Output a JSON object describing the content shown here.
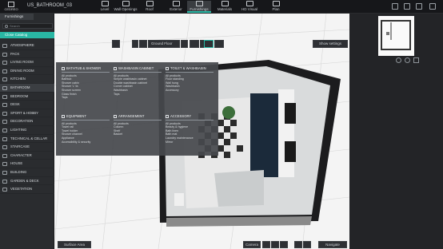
{
  "app": {
    "logo_text": "CEDREO",
    "project_title": "US_BATHROOM_03"
  },
  "toolbar": [
    {
      "label": "Level",
      "icon": "level-icon",
      "active": false
    },
    {
      "label": "Wall Openings",
      "icon": "door-icon",
      "active": false
    },
    {
      "label": "Roof",
      "icon": "roof-icon",
      "active": false
    },
    {
      "label": "Exterior",
      "icon": "house-icon",
      "active": false
    },
    {
      "label": "Furnishings",
      "icon": "sofa-icon",
      "active": true
    },
    {
      "label": "Materials",
      "icon": "paint-icon",
      "active": false
    },
    {
      "label": "HD Visual",
      "icon": "camera-icon",
      "active": false
    },
    {
      "label": "Plan",
      "icon": "plan-icon",
      "active": false
    }
  ],
  "sidebar": {
    "tab": "Furnishings",
    "search_placeholder": "Search",
    "close_catalog": "Close Catalog",
    "categories": [
      {
        "label": "ATMOSPHERE",
        "active": false
      },
      {
        "label": "PACK",
        "active": false
      },
      {
        "label": "LIVING ROOM",
        "active": false
      },
      {
        "label": "DINING ROOM",
        "active": false
      },
      {
        "label": "KITCHEN",
        "active": false
      },
      {
        "label": "BATHROOM",
        "active": true
      },
      {
        "label": "BEDROOM",
        "active": false
      },
      {
        "label": "DESK",
        "active": false
      },
      {
        "label": "SPORT & HOBBY",
        "active": false
      },
      {
        "label": "DECORATION",
        "active": false
      },
      {
        "label": "LIGHTING",
        "active": false
      },
      {
        "label": "TECHNICAL & CELLAR",
        "active": false
      },
      {
        "label": "STAIRCASE",
        "active": false
      },
      {
        "label": "CHARACTER",
        "active": false
      },
      {
        "label": "HOUSE",
        "active": false
      },
      {
        "label": "BUILDING",
        "active": false
      },
      {
        "label": "GARDEN & DECK",
        "active": false
      },
      {
        "label": "VEGETATION",
        "active": false
      }
    ]
  },
  "view_toolbar": {
    "floor": "Ground Floor",
    "show_settings": "Show settings"
  },
  "mega_menu": [
    {
      "heading": "BATHTUB & SHOWER",
      "items": [
        "All products",
        "Bathtub",
        "Shower cabin",
        "Shower 'L' fa",
        "Shower screen",
        "Glass finish",
        "Taps"
      ]
    },
    {
      "heading": "WASHBASIN CABINET",
      "items": [
        "All products",
        "Simple washbasin cabinet",
        "Double washbasin cabinet",
        "Corner cabinet",
        "Washbasin",
        "Taps"
      ]
    },
    {
      "heading": "TOILET & WASHBASIN",
      "items": [
        "All products",
        "Floor standing",
        "Wall hung",
        "Washbasin",
        "Accessory"
      ]
    },
    {
      "heading": "EQUIPMENT",
      "items": [
        "All products",
        "Towel rail",
        "Towel holder",
        "Shower channel",
        "Appliance",
        "Accessibility & security"
      ]
    },
    {
      "heading": "ARRANGEMENT",
      "items": [
        "All products",
        "Column",
        "Shelf",
        "Basket"
      ]
    },
    {
      "heading": "ACCESSORY",
      "items": [
        "All products",
        "Beauty & hygiene",
        "Bath linen",
        "Bath mat",
        "Laundry maintenance",
        "Mirror"
      ]
    }
  ],
  "bottom": {
    "surface_area": "Surface Area",
    "camera": "Camera",
    "navigate": "Navigate"
  },
  "colors": {
    "accent": "#29b7a4",
    "panel": "#2a2c2f",
    "topbar": "#16171a"
  }
}
